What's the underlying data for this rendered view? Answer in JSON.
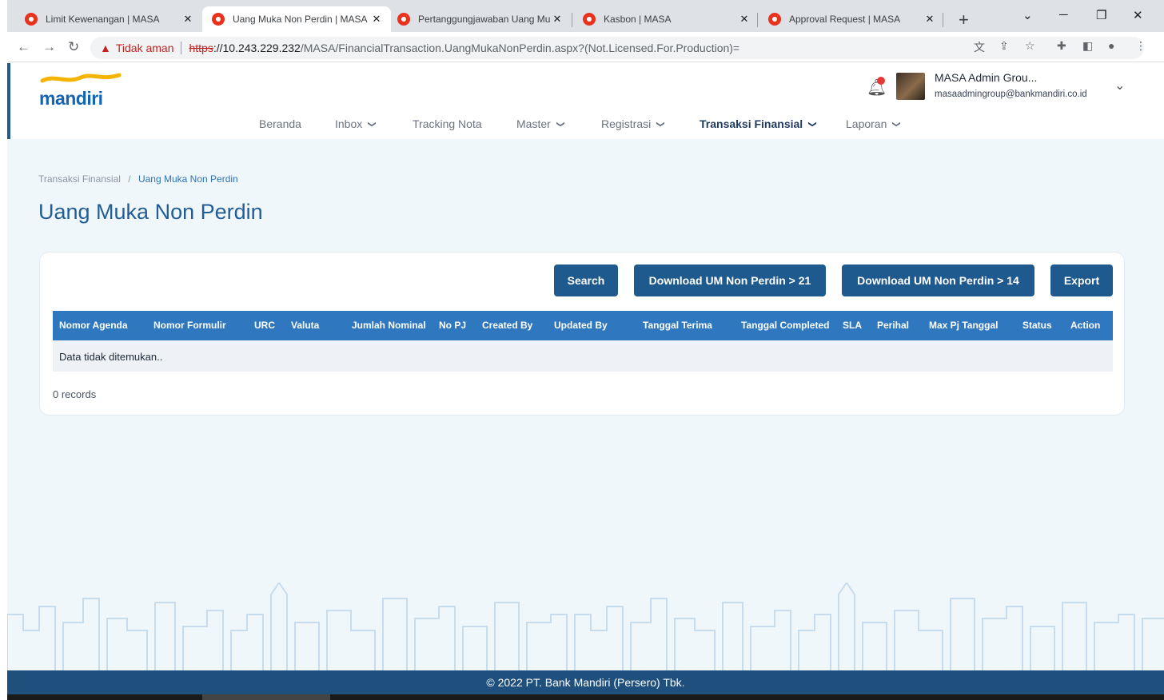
{
  "browser": {
    "tabs": [
      {
        "title": "Limit Kewenangan | MASA",
        "active": false
      },
      {
        "title": "Uang Muka Non Perdin | MASA",
        "active": true
      },
      {
        "title": "Pertanggungjawaban Uang Mu",
        "active": false
      },
      {
        "title": "Kasbon | MASA",
        "active": false
      },
      {
        "title": "Approval Request | MASA",
        "active": false
      }
    ],
    "security_label": "Tidak aman",
    "url_scheme": "https",
    "url_host": "://10.243.229.232",
    "url_path": "/MASA/FinancialTransaction.UangMukaNonPerdin.aspx?(Not.Licensed.For.Production)="
  },
  "header": {
    "logo_text": "mandiri",
    "user_name": "MASA Admin Grou...",
    "user_email": "masaadmingroup@bankmandiri.co.id"
  },
  "menu": {
    "beranda": "Beranda",
    "inbox": "Inbox",
    "tracking": "Tracking Nota",
    "master": "Master",
    "registrasi": "Registrasi",
    "transaksi": "Transaksi Finansial",
    "laporan": "Laporan"
  },
  "breadcrumb": {
    "parent": "Transaksi Finansial",
    "separator": "/",
    "current": "Uang Muka Non Perdin"
  },
  "page_title": "Uang Muka Non Perdin",
  "toolbar": {
    "search": "Search",
    "download21": "Download UM Non Perdin > 21",
    "download14": "Download UM Non Perdin > 14",
    "export": "Export"
  },
  "table": {
    "columns": [
      "Nomor Agenda",
      "Nomor Formulir",
      "URC",
      "Valuta",
      "Jumlah Nominal",
      "No PJ",
      "Created By",
      "Updated By",
      "Tanggal Terima",
      "Tanggal Completed",
      "SLA",
      "Perihal",
      "Max Pj Tanggal",
      "Status",
      "Action"
    ],
    "empty_message": "Data tidak ditemukan..",
    "records": "0 records"
  },
  "footer": {
    "copyright": "© 2022 PT. Bank Mandiri (Persero) Tbk."
  },
  "colors": {
    "primary": "#1e5a8e",
    "table_header": "#2f78c0",
    "footer": "#1e4f7d",
    "background": "#f0f7fb"
  }
}
